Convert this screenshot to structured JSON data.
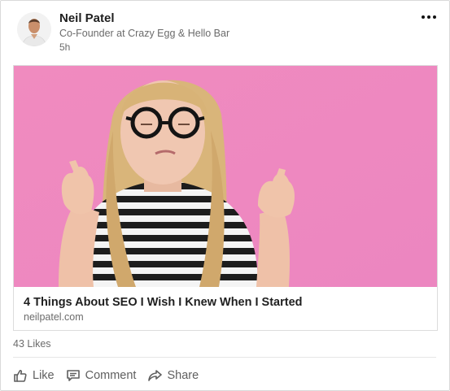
{
  "post": {
    "author": {
      "name": "Neil Patel",
      "headline": "Co-Founder at Crazy Egg & Hello Bar",
      "time": "5h"
    },
    "more_menu_icon": "ellipsis-icon",
    "article": {
      "title": "4 Things About SEO I Wish I Knew When I Started",
      "source": "neilpatel.com",
      "image_background": "#ef8fc3"
    },
    "likes": "43 Likes",
    "actions": [
      {
        "label": "Like",
        "icon": "thumbs-up-icon"
      },
      {
        "label": "Comment",
        "icon": "comment-icon"
      },
      {
        "label": "Share",
        "icon": "share-arrow-icon"
      }
    ]
  },
  "colors": {
    "text_primary": "#1f1f1f",
    "text_secondary": "#6b6b6b",
    "border": "#d9d9d9"
  }
}
